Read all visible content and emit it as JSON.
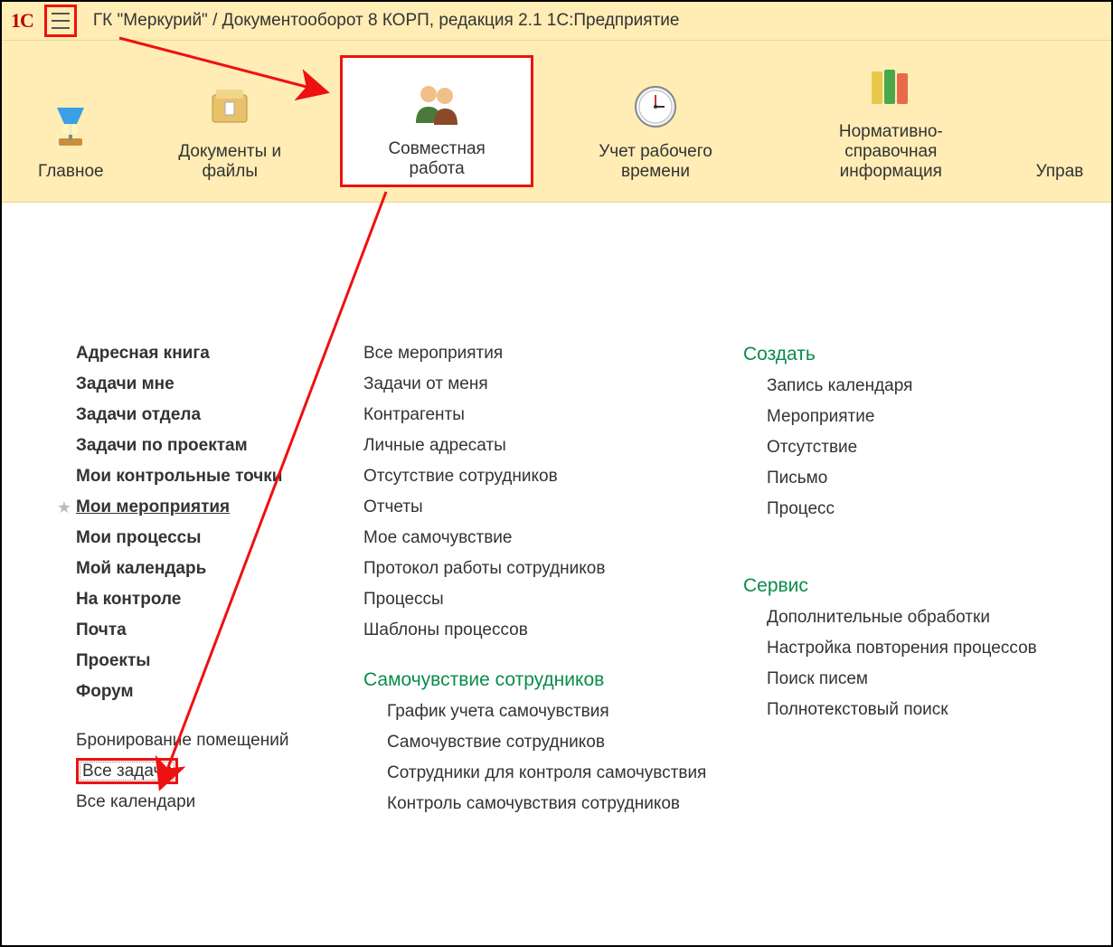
{
  "titlebar": {
    "logo": "1C",
    "title": "ГК \"Меркурий\" / Документооборот 8 КОРП, редакция 2.1 1С:Предприятие"
  },
  "sections": [
    {
      "label": "Главное",
      "icon": "lamp"
    },
    {
      "label": "Документы и файлы",
      "icon": "folder"
    },
    {
      "label": "Совместная работа",
      "icon": "people",
      "active": true
    },
    {
      "label": "Учет рабочего времени",
      "icon": "clock"
    },
    {
      "label": "Нормативно-справочная\nинформация",
      "icon": "books"
    },
    {
      "label": "Управ",
      "icon": "none"
    }
  ],
  "col1": {
    "bold": [
      "Адресная книга",
      "Задачи мне",
      "Задачи отдела",
      "Задачи по проектам",
      "Мои контрольные точки",
      "Мои мероприятия",
      "Мои процессы",
      "Мой календарь",
      "На контроле",
      "Почта",
      "Проекты",
      "Форум"
    ],
    "starred_index": 5,
    "plain": [
      "Бронирование помещений",
      "Все задачи",
      "Все календари"
    ],
    "highlighted_index": 1
  },
  "col2": {
    "group1": [
      "Все мероприятия",
      "Задачи от меня",
      "Контрагенты",
      "Личные адресаты",
      "Отсутствие сотрудников",
      "Отчеты",
      "Мое самочувствие",
      "Протокол работы сотрудников",
      "Процессы",
      "Шаблоны процессов"
    ],
    "heading2": "Самочувствие сотрудников",
    "group2": [
      "График учета самочувствия",
      "Самочувствие сотрудников",
      "Сотрудники для контроля самочувствия",
      "Контроль самочувствия сотрудников"
    ]
  },
  "col3": {
    "heading1": "Создать",
    "group1": [
      "Запись календаря",
      "Мероприятие",
      "Отсутствие",
      "Письмо",
      "Процесс"
    ],
    "heading2": "Сервис",
    "group2": [
      "Дополнительные обработки",
      "Настройка повторения процессов",
      "Поиск писем",
      "Полнотекстовый поиск"
    ]
  }
}
